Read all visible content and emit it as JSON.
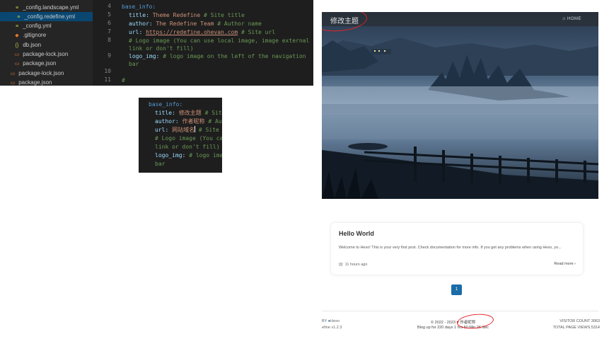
{
  "explorer": {
    "files": [
      {
        "name": "_config.landscape.yml",
        "icon": "yaml-icon",
        "active": false
      },
      {
        "name": "_config.redefine.yml",
        "icon": "yaml-icon",
        "active": true
      },
      {
        "name": "_config.yml",
        "icon": "yaml-icon",
        "active": false
      },
      {
        "name": ".gitignore",
        "icon": "git-icon",
        "active": false
      },
      {
        "name": "db.json",
        "icon": "json-icon",
        "active": false
      },
      {
        "name": "package-lock.json",
        "icon": "json-icon",
        "active": false
      },
      {
        "name": "package.json",
        "icon": "json-icon",
        "active": false
      },
      {
        "name": "package-lock.json",
        "icon": "json-icon",
        "active": false
      },
      {
        "name": "package.json",
        "icon": "json-icon",
        "active": false
      }
    ]
  },
  "editor": {
    "line_numbers": [
      "4",
      "5",
      "6",
      "7",
      "8",
      "",
      "9",
      "",
      "10",
      "11"
    ],
    "line4_key": "base_info:",
    "line5_key": "title:",
    "line5_val": "Theme Redefine",
    "line5_comment": "# Site title",
    "line6_key": "author:",
    "line6_val": "The Redefine Team",
    "line6_comment": "# Author name",
    "line7_key": "url:",
    "line7_val": "https://redefine.ohevan.com",
    "line7_comment": "# Site url",
    "line8_comment_a": "# Logo image (You can use local image, image external",
    "line8_comment_b": "link or don't fill)",
    "line9_key": "logo_img:",
    "line9_comment": "# logo image on the left of the navigation",
    "line9_comment_b": "bar",
    "line11_text": "#"
  },
  "snippet": {
    "l1": "base_info:",
    "l2_key": "title:",
    "l2_val": "修改主题",
    "l2_comment": "# Sit",
    "l3_key": "author:",
    "l3_val": "作者昵称",
    "l3_comment": "# Au",
    "l4_key": "url:",
    "l4_val": "网站域名",
    "l4_comment": "# Site",
    "l5": "# Logo image (You ca",
    "l6": "link or don't fill)",
    "l7_key": "logo_img:",
    "l7_comment": "# logo imag",
    "l8": "bar"
  },
  "blog": {
    "site_title": "修改主题",
    "nav_home": "HOME",
    "post": {
      "title": "Hello World",
      "excerpt": "Welcome to Hexo! This is your very first post. Check documentation for more info. If you get any problems when using Hexo, yo...",
      "date": "11 hours ago",
      "read_more": "Read more ›"
    },
    "page_current": "1",
    "footer": {
      "powered": "BY",
      "hexo": "Hexo",
      "theme": "efine v1.2.3",
      "copyright": "© 2022 - 2023",
      "author": "作者昵称",
      "uptime": "Blog up for 220 days 1 hrs 50 Min 26 Sec",
      "visitor_count": "VISITOR COUNT 3063",
      "page_views": "TOTAL PAGE VIEWS 5314"
    }
  },
  "colors": {
    "annotation": "#e3242b",
    "accent": "#1b6ca8"
  }
}
